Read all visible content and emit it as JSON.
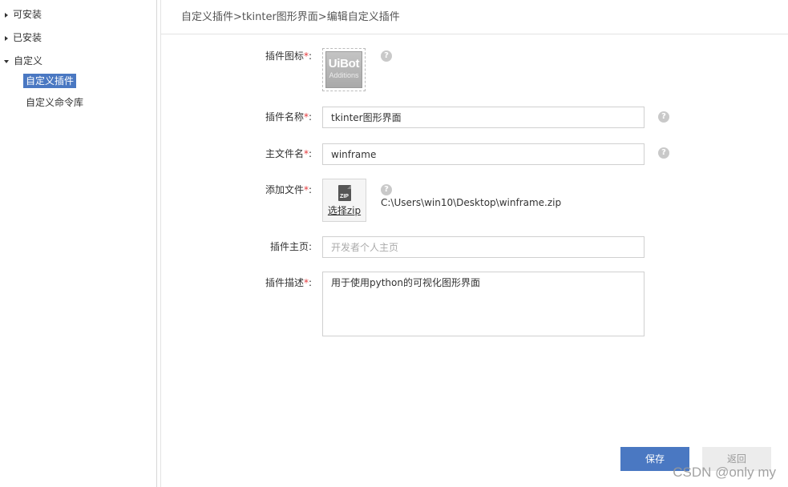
{
  "sidebar": {
    "items": [
      {
        "label": "可安装",
        "expanded": false
      },
      {
        "label": "已安装",
        "expanded": false
      },
      {
        "label": "自定义",
        "expanded": true
      }
    ],
    "children": [
      {
        "label": "自定义插件",
        "selected": true
      },
      {
        "label": "自定义命令库",
        "selected": false
      }
    ]
  },
  "breadcrumb": "自定义插件>tkinter图形界面>编辑自定义插件",
  "form": {
    "icon": {
      "label": "插件图标",
      "required": "*",
      "colon": ":",
      "logo_title": "UiBot",
      "logo_subtitle": "Additions"
    },
    "name": {
      "label": "插件名称",
      "required": "*",
      "colon": ":",
      "value": "tkinter图形界面"
    },
    "main_file": {
      "label": "主文件名",
      "required": "*",
      "colon": ":",
      "value": "winframe"
    },
    "add_file": {
      "label": "添加文件",
      "required": "*",
      "colon": ":",
      "button_label": "选择zip",
      "button_icon_text": "ZIP",
      "file_path": "C:\\Users\\win10\\Desktop\\winframe.zip"
    },
    "homepage": {
      "label": "插件主页",
      "colon": ":",
      "value": "",
      "placeholder": "开发者个人主页"
    },
    "description": {
      "label": "插件描述",
      "required": "*",
      "colon": ":",
      "value": "用于使用python的可视化图形界面"
    },
    "help_glyph": "?"
  },
  "actions": {
    "save_label": "保存",
    "back_label": "返回"
  },
  "watermark": "CSDN @only my",
  "colors": {
    "accent": "#4a78c2",
    "required": "#e4393c",
    "border": "#d0d0d0"
  }
}
